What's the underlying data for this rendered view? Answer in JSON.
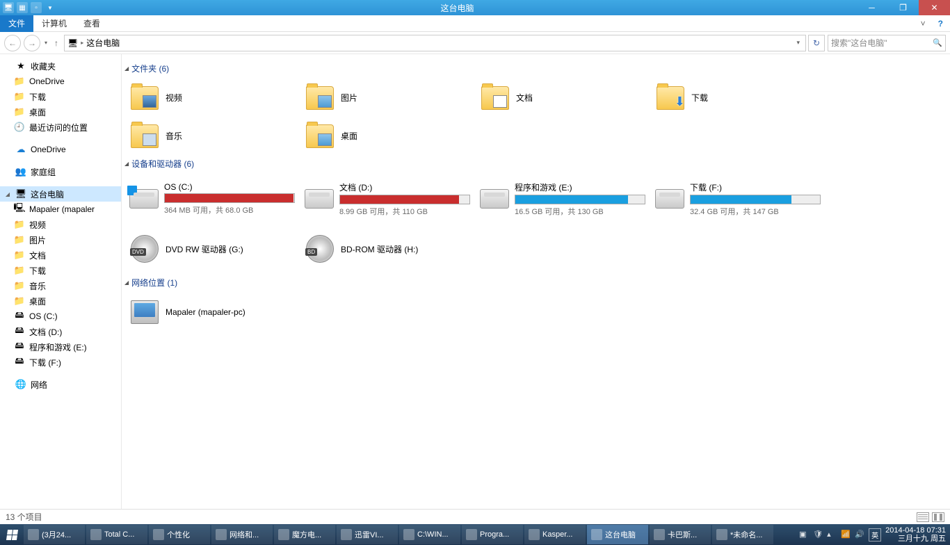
{
  "window": {
    "title": "这台电脑"
  },
  "ribbon": {
    "file": "文件",
    "computer": "计算机",
    "view": "查看"
  },
  "address": {
    "crumb": "这台电脑",
    "search_placeholder": "搜索\"这台电脑\""
  },
  "nav": {
    "favorites": {
      "label": "收藏夹",
      "items": [
        "OneDrive",
        "下载",
        "桌面",
        "最近访问的位置"
      ]
    },
    "onedrive": "OneDrive",
    "homegroup": "家庭组",
    "thispc": {
      "label": "这台电脑",
      "items": [
        "Mapaler (mapaler",
        "视频",
        "图片",
        "文档",
        "下载",
        "音乐",
        "桌面",
        "OS (C:)",
        "文档 (D:)",
        "程序和游戏 (E:)",
        "下载 (F:)"
      ]
    },
    "network": "网络"
  },
  "groups": {
    "folders": {
      "title": "文件夹 (6)",
      "items": [
        "视频",
        "图片",
        "文档",
        "下载",
        "音乐",
        "桌面"
      ]
    },
    "drives": {
      "title": "设备和驱动器 (6)",
      "items": [
        {
          "name": "OS (C:)",
          "detail": "364 MB 可用，共 68.0 GB",
          "pct": 99.5,
          "color": "#c92e2e"
        },
        {
          "name": "文档 (D:)",
          "detail": "8.99 GB 可用，共 110 GB",
          "pct": 92,
          "color": "#c92e2e"
        },
        {
          "name": "程序和游戏 (E:)",
          "detail": "16.5 GB 可用，共 130 GB",
          "pct": 87,
          "color": "#1a9fe0"
        },
        {
          "name": "下载 (F:)",
          "detail": "32.4 GB 可用，共 147 GB",
          "pct": 78,
          "color": "#1a9fe0"
        },
        {
          "name": "DVD RW 驱动器 (G:)",
          "type": "disc",
          "badge": "DVD"
        },
        {
          "name": "BD-ROM 驱动器 (H:)",
          "type": "disc",
          "badge": "BD"
        }
      ]
    },
    "netloc": {
      "title": "网络位置 (1)",
      "items": [
        "Mapaler (mapaler-pc)"
      ]
    }
  },
  "status": {
    "count": "13 个项目"
  },
  "taskbar": {
    "buttons": [
      "(3月24...",
      "Total C...",
      "个性化",
      "网络和...",
      "魔方电...",
      "迅雷VI...",
      "C:\\WIN...",
      "Progra...",
      "Kasper...",
      "这台电脑",
      "卡巴斯...",
      "*未命名..."
    ],
    "active_index": 9,
    "ime": "英",
    "clock_time": "2014-04-18 07:31",
    "clock_date": "三月十九 周五"
  }
}
